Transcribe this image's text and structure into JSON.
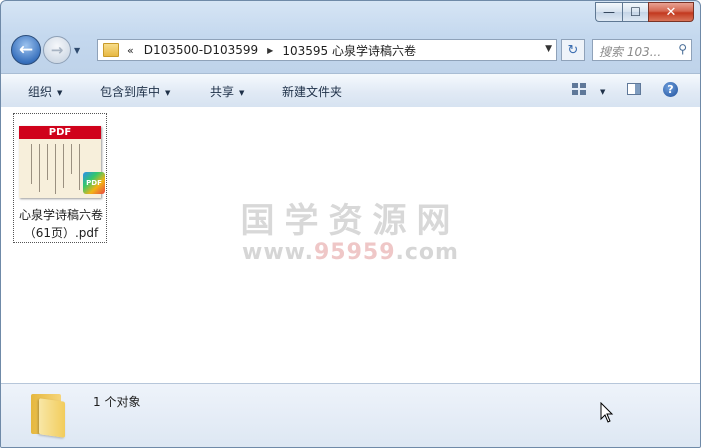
{
  "window": {
    "caption_buttons": {
      "minimize": "—",
      "maximize": "☐",
      "close": "✕"
    }
  },
  "address_bar": {
    "overflow": "«",
    "crumbs": [
      "D103500-D103599",
      "103595 心泉学诗稿六卷"
    ]
  },
  "search": {
    "placeholder": "搜索 103..."
  },
  "toolbar": {
    "organize": "组织",
    "include_in_library": "包含到库中",
    "share": "共享",
    "new_folder": "新建文件夹"
  },
  "files": [
    {
      "name_line1": "心泉学诗稿六卷",
      "name_line2": "（61页）.pdf",
      "thumb_badge": "PDF",
      "type_badge": "PDF"
    }
  ],
  "watermark": {
    "line1": "国学资源网",
    "line2_a": "www.",
    "line2_b": "95959",
    "line2_c": ".com"
  },
  "status": {
    "count_text": "1 个对象"
  },
  "colors": {
    "window_frame": "#c4d8ee",
    "close_button": "#c3391f",
    "pdf_red": "#d0021b"
  }
}
